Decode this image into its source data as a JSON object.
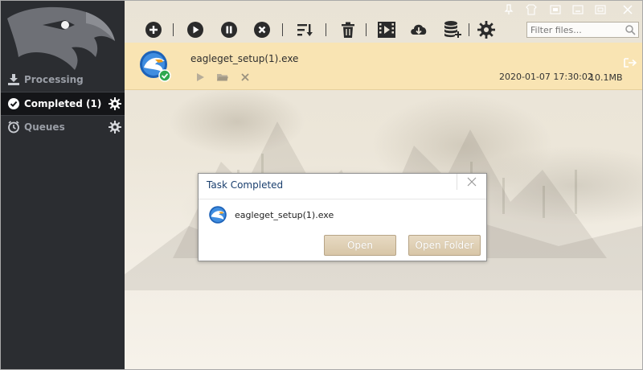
{
  "sidebar": {
    "items": [
      {
        "label": "Processing",
        "icon": "download-tray-icon"
      },
      {
        "label": "Completed (1)",
        "icon": "check-circle-icon"
      },
      {
        "label": "Queues",
        "icon": "clock-icon"
      }
    ]
  },
  "toolbar": {
    "buttons": [
      {
        "icon": "add-icon"
      },
      {
        "icon": "play-icon"
      },
      {
        "icon": "pause-icon"
      },
      {
        "icon": "stop-icon"
      },
      {
        "icon": "sort-icon"
      },
      {
        "icon": "trash-icon"
      },
      {
        "icon": "video-icon"
      },
      {
        "icon": "cloud-download-icon"
      },
      {
        "icon": "database-add-icon"
      },
      {
        "icon": "gear-icon"
      }
    ],
    "filter_placeholder": "Filter files..."
  },
  "download": {
    "filename": "eagleget_setup(1).exe",
    "datetime": "2020-01-07 17:30:02",
    "size": "10.1MB",
    "status": "completed"
  },
  "dialog": {
    "title": "Task Completed",
    "filename": "eagleget_setup(1).exe",
    "open_label": "Open",
    "open_folder_label": "Open Folder"
  },
  "colors": {
    "sidebar_bg": "#2b2d31",
    "row_highlight": "#f9e4b3",
    "button_bg": "#d8c6a7",
    "success_green": "#2fa84f"
  }
}
